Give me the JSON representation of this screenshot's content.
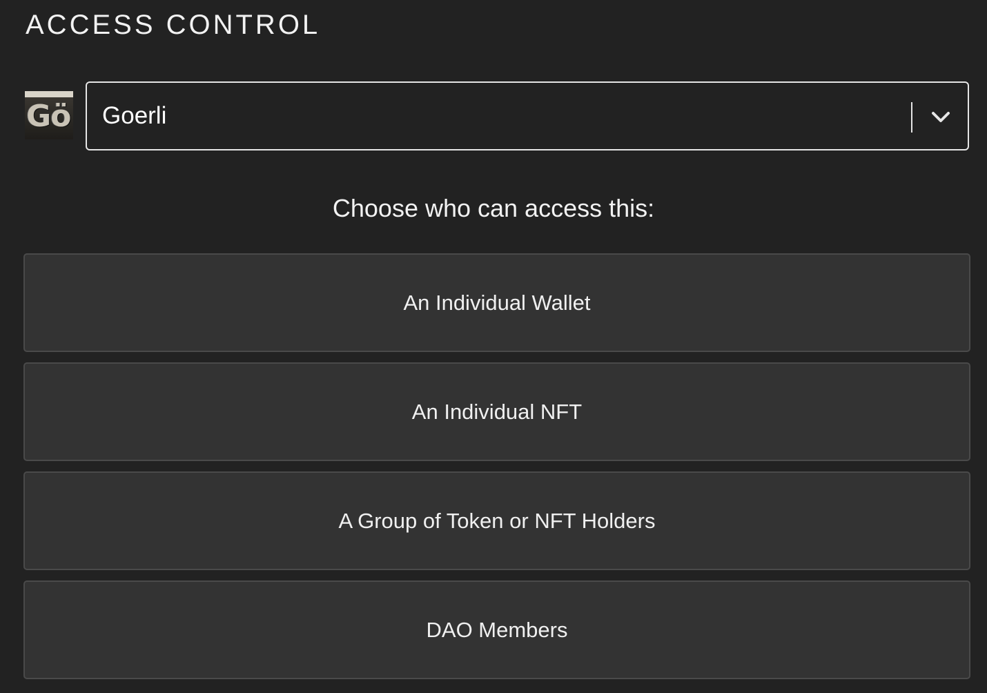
{
  "section": {
    "title": "ACCESS CONTROL"
  },
  "chain_selector": {
    "logo_icon": "goerli-logo-icon",
    "logo_text": "Gö",
    "selected_value": "Goerli",
    "chevron_icon": "chevron-down-icon"
  },
  "prompt": "Choose who can access this:",
  "options": [
    {
      "label": "An Individual Wallet"
    },
    {
      "label": "An Individual NFT"
    },
    {
      "label": "A Group of Token or NFT Holders"
    },
    {
      "label": "DAO Members"
    }
  ],
  "colors": {
    "background": "#222222",
    "option_background": "#333333",
    "option_border": "#4a4a4a",
    "text": "#ffffff",
    "select_border": "#e6e6e6"
  }
}
